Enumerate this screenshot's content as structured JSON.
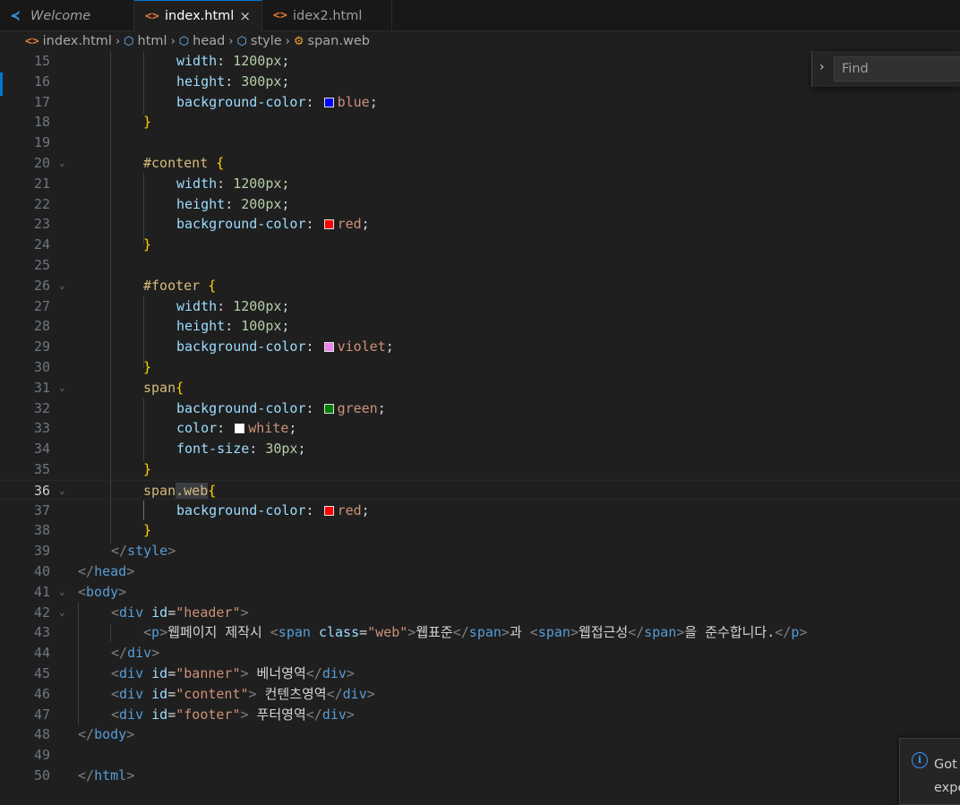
{
  "tabs": [
    {
      "label": "Welcome",
      "icon": "vscode-logo-icon",
      "active": false
    },
    {
      "label": "index.html",
      "icon": "html-file-icon",
      "active": true,
      "close": "×"
    },
    {
      "label": "idex2.html",
      "icon": "html-file-icon",
      "active": false
    }
  ],
  "breadcrumb": [
    "index.html",
    "html",
    "head",
    "style",
    "span.web"
  ],
  "find": {
    "placeholder": "Find",
    "chevron": "›"
  },
  "notification": {
    "line1": "Got",
    "line2": "expe"
  },
  "icon_glyphs": {
    "html": "<>",
    "element": "⬡",
    "style": "⚙"
  },
  "colors": {
    "accent": "#0078d4",
    "blue": "#0000ff",
    "red": "#ff0000",
    "violet": "#ee82ee",
    "green": "#008000",
    "white": "#ffffff"
  },
  "lines": [
    {
      "n": "15",
      "segs": [
        [
          "p",
          "width"
        ],
        [
          "d",
          ": "
        ],
        [
          "n",
          "1200px"
        ],
        [
          "d",
          ";"
        ]
      ]
    },
    {
      "n": "16",
      "segs": [
        [
          "p",
          "height"
        ],
        [
          "d",
          ": "
        ],
        [
          "n",
          "300px"
        ],
        [
          "d",
          ";"
        ]
      ]
    },
    {
      "n": "17",
      "segs": [
        [
          "p",
          "background-color"
        ],
        [
          "d",
          ": "
        ],
        [
          "sw",
          "blue"
        ],
        [
          "v",
          "blue"
        ],
        [
          "d",
          ";"
        ]
      ]
    },
    {
      "n": "18",
      "segs": [
        [
          "b",
          "}"
        ]
      ]
    },
    {
      "n": "19",
      "segs": []
    },
    {
      "n": "20",
      "fold": true,
      "segs": [
        [
          "s",
          "#content "
        ],
        [
          "b",
          "{"
        ]
      ]
    },
    {
      "n": "21",
      "segs": [
        [
          "p",
          "width"
        ],
        [
          "d",
          ": "
        ],
        [
          "n",
          "1200px"
        ],
        [
          "d",
          ";"
        ]
      ]
    },
    {
      "n": "22",
      "segs": [
        [
          "p",
          "height"
        ],
        [
          "d",
          ": "
        ],
        [
          "n",
          "200px"
        ],
        [
          "d",
          ";"
        ]
      ]
    },
    {
      "n": "23",
      "segs": [
        [
          "p",
          "background-color"
        ],
        [
          "d",
          ": "
        ],
        [
          "sw",
          "red"
        ],
        [
          "v",
          "red"
        ],
        [
          "d",
          ";"
        ]
      ]
    },
    {
      "n": "24",
      "segs": [
        [
          "b",
          "}"
        ]
      ]
    },
    {
      "n": "25",
      "segs": []
    },
    {
      "n": "26",
      "fold": true,
      "segs": [
        [
          "s",
          "#footer "
        ],
        [
          "b",
          "{"
        ]
      ]
    },
    {
      "n": "27",
      "segs": [
        [
          "p",
          "width"
        ],
        [
          "d",
          ": "
        ],
        [
          "n",
          "1200px"
        ],
        [
          "d",
          ";"
        ]
      ]
    },
    {
      "n": "28",
      "segs": [
        [
          "p",
          "height"
        ],
        [
          "d",
          ": "
        ],
        [
          "n",
          "100px"
        ],
        [
          "d",
          ";"
        ]
      ]
    },
    {
      "n": "29",
      "segs": [
        [
          "p",
          "background-color"
        ],
        [
          "d",
          ": "
        ],
        [
          "sw",
          "violet"
        ],
        [
          "v",
          "violet"
        ],
        [
          "d",
          ";"
        ]
      ]
    },
    {
      "n": "30",
      "segs": [
        [
          "b",
          "}"
        ]
      ]
    },
    {
      "n": "31",
      "fold": true,
      "segs": [
        [
          "s",
          "span"
        ],
        [
          "b",
          "{"
        ]
      ]
    },
    {
      "n": "32",
      "segs": [
        [
          "p",
          "background-color"
        ],
        [
          "d",
          ": "
        ],
        [
          "sw",
          "green"
        ],
        [
          "v",
          "green"
        ],
        [
          "d",
          ";"
        ]
      ]
    },
    {
      "n": "33",
      "segs": [
        [
          "p",
          "color"
        ],
        [
          "d",
          ": "
        ],
        [
          "sw",
          "white"
        ],
        [
          "v",
          "white"
        ],
        [
          "d",
          ";"
        ]
      ]
    },
    {
      "n": "34",
      "segs": [
        [
          "p",
          "font-size"
        ],
        [
          "d",
          ": "
        ],
        [
          "n",
          "30px"
        ],
        [
          "d",
          ";"
        ]
      ]
    },
    {
      "n": "35",
      "segs": [
        [
          "b",
          "}"
        ]
      ]
    },
    {
      "n": "36",
      "fold": true,
      "current": true,
      "segs": [
        [
          "s",
          "span"
        ],
        [
          "sh",
          ".web"
        ],
        [
          "b",
          "{"
        ]
      ]
    },
    {
      "n": "37",
      "segs": [
        [
          "p",
          "background-color"
        ],
        [
          "d",
          ": "
        ],
        [
          "sw",
          "red"
        ],
        [
          "v",
          "red"
        ],
        [
          "d",
          ";"
        ]
      ]
    },
    {
      "n": "38",
      "segs": [
        [
          "b",
          "}"
        ]
      ]
    },
    {
      "n": "39",
      "segs": [
        [
          "g",
          "</"
        ],
        [
          "t",
          "style"
        ],
        [
          "g",
          ">"
        ]
      ]
    },
    {
      "n": "40",
      "segs": [
        [
          "g",
          "</"
        ],
        [
          "t",
          "head"
        ],
        [
          "g",
          ">"
        ]
      ]
    },
    {
      "n": "41",
      "fold": true,
      "segs": [
        [
          "g",
          "<"
        ],
        [
          "t",
          "body"
        ],
        [
          "g",
          ">"
        ]
      ]
    },
    {
      "n": "42",
      "fold": true,
      "segs": [
        [
          "g",
          "<"
        ],
        [
          "t",
          "div"
        ],
        [
          "d",
          " "
        ],
        [
          "a",
          "id"
        ],
        [
          "d",
          "="
        ],
        [
          "st",
          "\"header\""
        ],
        [
          "g",
          ">"
        ]
      ]
    },
    {
      "n": "43",
      "segs": [
        [
          "g",
          "<"
        ],
        [
          "t",
          "p"
        ],
        [
          "g",
          ">"
        ],
        [
          "x",
          "웹페이지 제작시 "
        ],
        [
          "g",
          "<"
        ],
        [
          "t",
          "span"
        ],
        [
          "d",
          " "
        ],
        [
          "a",
          "class"
        ],
        [
          "d",
          "="
        ],
        [
          "st",
          "\"web\""
        ],
        [
          "g",
          ">"
        ],
        [
          "x",
          "웹표준"
        ],
        [
          "g",
          "</"
        ],
        [
          "t",
          "span"
        ],
        [
          "g",
          ">"
        ],
        [
          "x",
          "과 "
        ],
        [
          "g",
          "<"
        ],
        [
          "t",
          "span"
        ],
        [
          "g",
          ">"
        ],
        [
          "x",
          "웹접근성"
        ],
        [
          "g",
          "</"
        ],
        [
          "t",
          "span"
        ],
        [
          "g",
          ">"
        ],
        [
          "x",
          "을 준수합니다."
        ],
        [
          "g",
          "</"
        ],
        [
          "t",
          "p"
        ],
        [
          "g",
          ">"
        ]
      ]
    },
    {
      "n": "44",
      "segs": [
        [
          "g",
          "</"
        ],
        [
          "t",
          "div"
        ],
        [
          "g",
          ">"
        ]
      ]
    },
    {
      "n": "45",
      "segs": [
        [
          "g",
          "<"
        ],
        [
          "t",
          "div"
        ],
        [
          "d",
          " "
        ],
        [
          "a",
          "id"
        ],
        [
          "d",
          "="
        ],
        [
          "st",
          "\"banner\""
        ],
        [
          "g",
          ">"
        ],
        [
          "x",
          " 베너영역"
        ],
        [
          "g",
          "</"
        ],
        [
          "t",
          "div"
        ],
        [
          "g",
          ">"
        ]
      ]
    },
    {
      "n": "46",
      "segs": [
        [
          "g",
          "<"
        ],
        [
          "t",
          "div"
        ],
        [
          "d",
          " "
        ],
        [
          "a",
          "id"
        ],
        [
          "d",
          "="
        ],
        [
          "st",
          "\"content\""
        ],
        [
          "g",
          ">"
        ],
        [
          "x",
          " 컨텐츠영역"
        ],
        [
          "g",
          "</"
        ],
        [
          "t",
          "div"
        ],
        [
          "g",
          ">"
        ]
      ]
    },
    {
      "n": "47",
      "segs": [
        [
          "g",
          "<"
        ],
        [
          "t",
          "div"
        ],
        [
          "d",
          " "
        ],
        [
          "a",
          "id"
        ],
        [
          "d",
          "="
        ],
        [
          "st",
          "\"footer\""
        ],
        [
          "g",
          ">"
        ],
        [
          "x",
          " 푸터영역"
        ],
        [
          "g",
          "</"
        ],
        [
          "t",
          "div"
        ],
        [
          "g",
          ">"
        ]
      ]
    },
    {
      "n": "48",
      "segs": [
        [
          "g",
          "</"
        ],
        [
          "t",
          "body"
        ],
        [
          "g",
          ">"
        ]
      ]
    },
    {
      "n": "49",
      "segs": []
    },
    {
      "n": "50",
      "segs": [
        [
          "g",
          "</"
        ],
        [
          "t",
          "html"
        ],
        [
          "g",
          ">"
        ]
      ]
    }
  ]
}
